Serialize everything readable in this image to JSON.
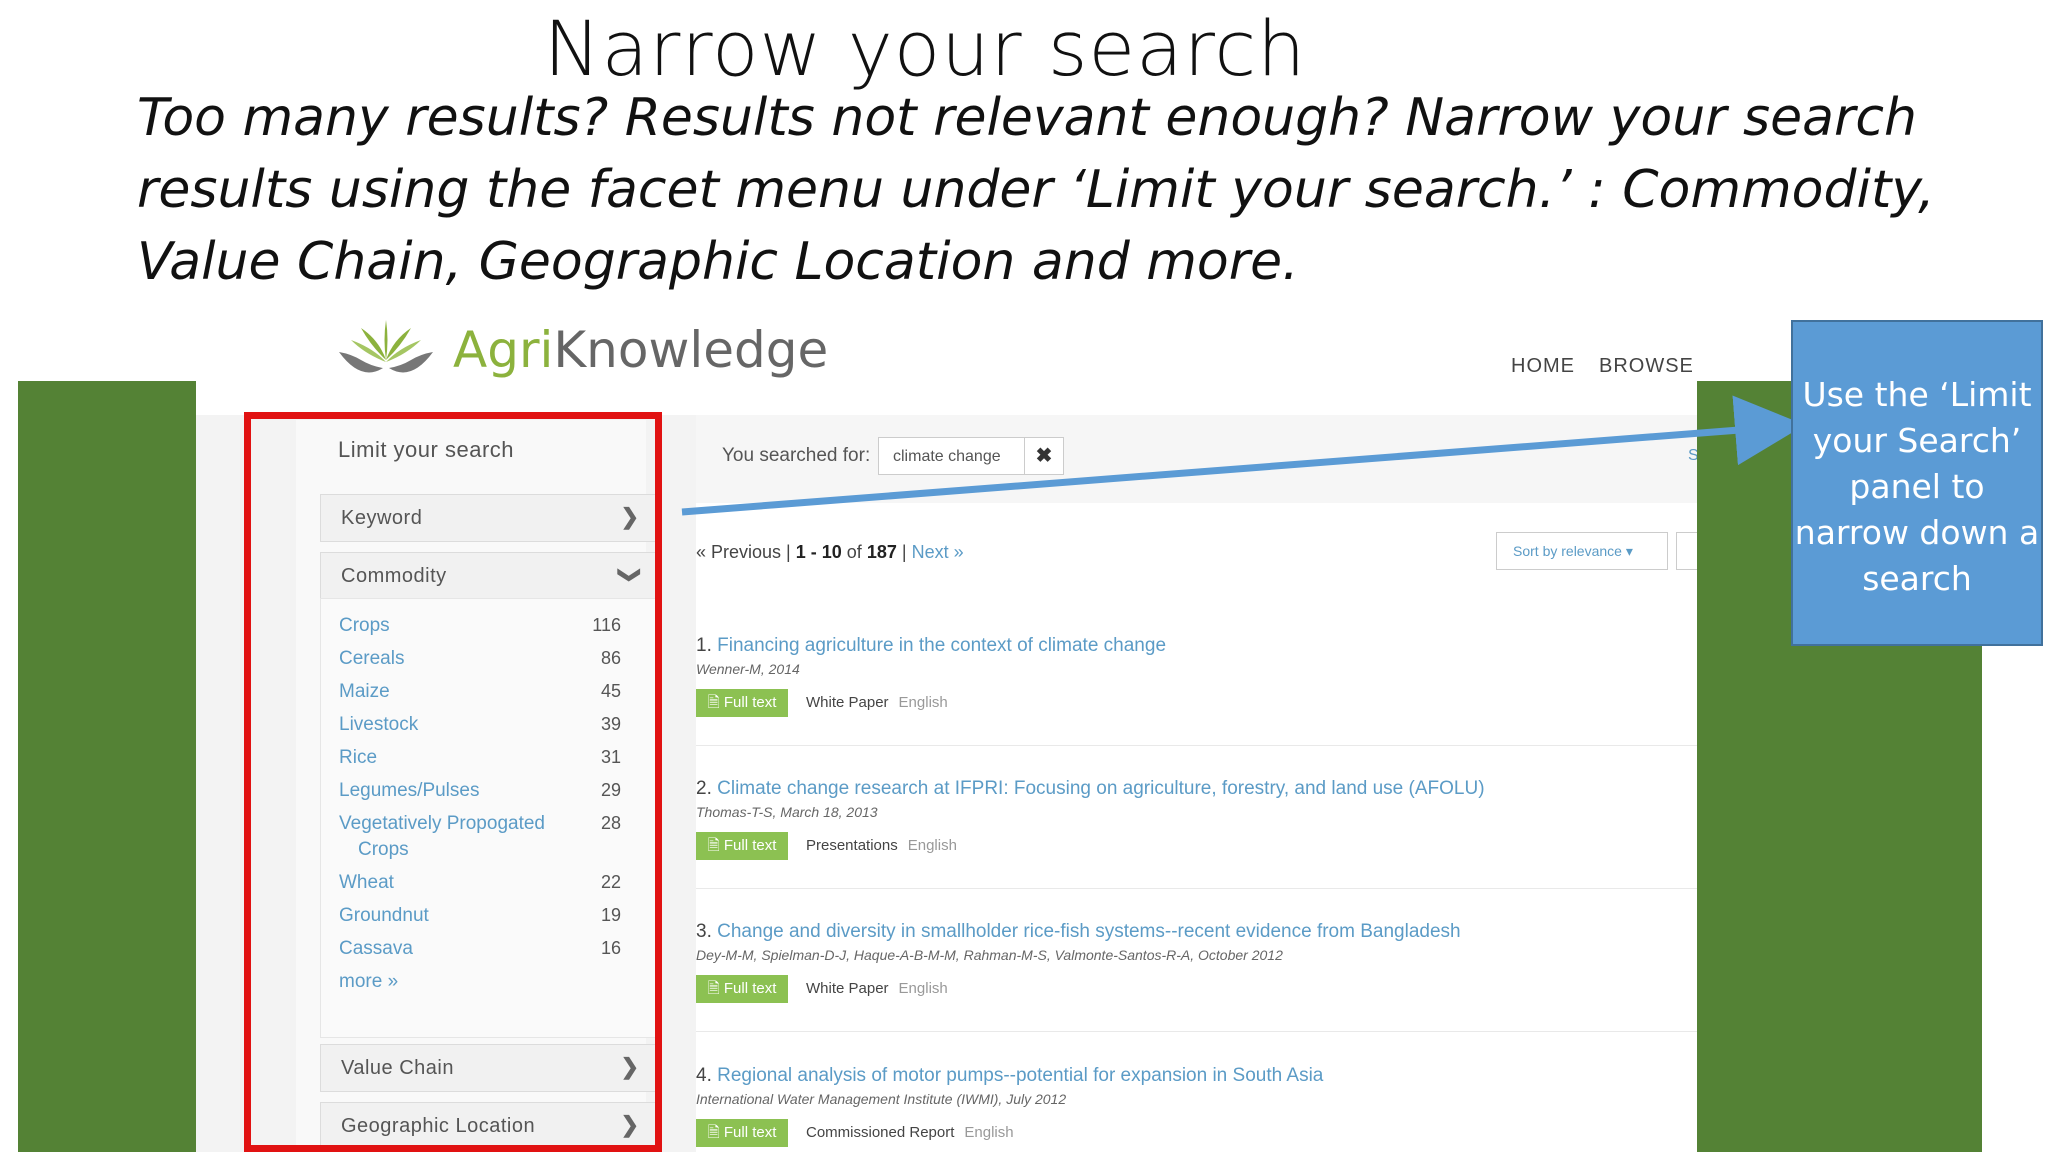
{
  "slide": {
    "title": "Narrow your search",
    "subtitle": "Too many results? Results not relevant enough? Narrow your search results using the facet menu under ‘Limit your search.’ : Commodity, Value Chain, Geographic Location and more."
  },
  "site": {
    "logo_prefix": "Agri",
    "logo_suffix": "Knowledge",
    "nav": [
      "HOME",
      "BROWSE"
    ]
  },
  "sidebar": {
    "title": "Limit your search",
    "facets": {
      "keyword": "Keyword",
      "commodity": "Commodity",
      "value_chain": "Value Chain",
      "geographic_location": "Geographic Location"
    },
    "commodity_items": [
      {
        "label": "Crops",
        "count": "116"
      },
      {
        "label": "Cereals",
        "count": "86"
      },
      {
        "label": "Maize",
        "count": "45"
      },
      {
        "label": "Livestock",
        "count": "39"
      },
      {
        "label": "Rice",
        "count": "31"
      },
      {
        "label": "Legumes/Pulses",
        "count": "29"
      },
      {
        "label": "Vegetatively Propogated",
        "label2": "Crops",
        "count": "28"
      },
      {
        "label": "Wheat",
        "count": "22"
      },
      {
        "label": "Groundnut",
        "count": "19"
      },
      {
        "label": "Cassava",
        "count": "16"
      }
    ],
    "more": "more »"
  },
  "search": {
    "prefix": "You searched for:",
    "query": "climate change",
    "remove": "✖",
    "edge_text": "S"
  },
  "pager": {
    "prev": "« Previous |",
    "range": "1 - 10",
    "of": "of",
    "total": "187",
    "sep": "|",
    "next": "Next »"
  },
  "sort": {
    "label": "Sort by relevance ▾"
  },
  "results": [
    {
      "number": "1.",
      "title": "Financing agriculture in the context of climate change",
      "authors": "Wenner-M, 2014",
      "full_text": "Full text",
      "type": "White Paper",
      "language": "English"
    },
    {
      "number": "2.",
      "title": "Climate change research at IFPRI: Focusing on agriculture, forestry, and land use (AFOLU)",
      "authors": "Thomas-T-S, March 18, 2013",
      "full_text": "Full text",
      "type": "Presentations",
      "language": "English"
    },
    {
      "number": "3.",
      "title": "Change and diversity in smallholder rice-fish systems--recent evidence from Bangladesh",
      "authors": "Dey-M-M, Spielman-D-J, Haque-A-B-M-M, Rahman-M-S, Valmonte-Santos-R-A, October 2012",
      "full_text": "Full text",
      "type": "White Paper",
      "language": "English"
    },
    {
      "number": "4.",
      "title": "Regional analysis of motor pumps--potential for expansion in South Asia",
      "authors": "International Water Management Institute (IWMI), July 2012",
      "full_text": "Full text",
      "type": "Commissioned Report",
      "language": "English"
    }
  ],
  "callout": {
    "text": "Use the ‘Limit your Search’ panel to narrow down a search"
  },
  "colors": {
    "slide_green": "#548235",
    "highlight_red": "#e11212",
    "callout_blue": "#5b9bd5",
    "link_blue": "#5b9bc6",
    "full_text_green": "#8cc152"
  }
}
